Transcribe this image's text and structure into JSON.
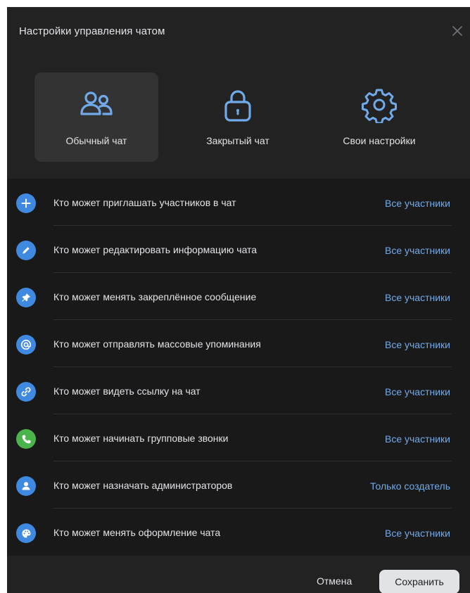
{
  "dialog": {
    "title": "Настройки управления чатом"
  },
  "presets": [
    {
      "label": "Обычный чат",
      "icon": "users-icon",
      "active": true
    },
    {
      "label": "Закрытый чат",
      "icon": "lock-icon",
      "active": false
    },
    {
      "label": "Свои настройки",
      "icon": "gear-icon",
      "active": false
    }
  ],
  "settings": [
    {
      "label": "Кто может приглашать участников в чат",
      "value": "Все участники",
      "icon": "plus-icon",
      "color": "#3f8ae0"
    },
    {
      "label": "Кто может редактировать информацию чата",
      "value": "Все участники",
      "icon": "pencil-icon",
      "color": "#3f8ae0"
    },
    {
      "label": "Кто может менять закреплённое сообщение",
      "value": "Все участники",
      "icon": "pin-icon",
      "color": "#3f8ae0"
    },
    {
      "label": "Кто может отправлять массовые упоминания",
      "value": "Все участники",
      "icon": "at-icon",
      "color": "#3f8ae0"
    },
    {
      "label": "Кто может видеть ссылку на чат",
      "value": "Все участники",
      "icon": "link-icon",
      "color": "#3f8ae0"
    },
    {
      "label": "Кто может начинать групповые звонки",
      "value": "Все участники",
      "icon": "phone-icon",
      "color": "#4bb34b"
    },
    {
      "label": "Кто может назначать администраторов",
      "value": "Только создатель",
      "icon": "user-icon",
      "color": "#3f8ae0"
    },
    {
      "label": "Кто может менять оформление чата",
      "value": "Все участники",
      "icon": "palette-icon",
      "color": "#3f8ae0"
    }
  ],
  "footer": {
    "cancel_label": "Отмена",
    "save_label": "Сохранить"
  },
  "colors": {
    "accent": "#71aaeb",
    "modal_bg": "#222222",
    "list_bg": "#191919"
  }
}
